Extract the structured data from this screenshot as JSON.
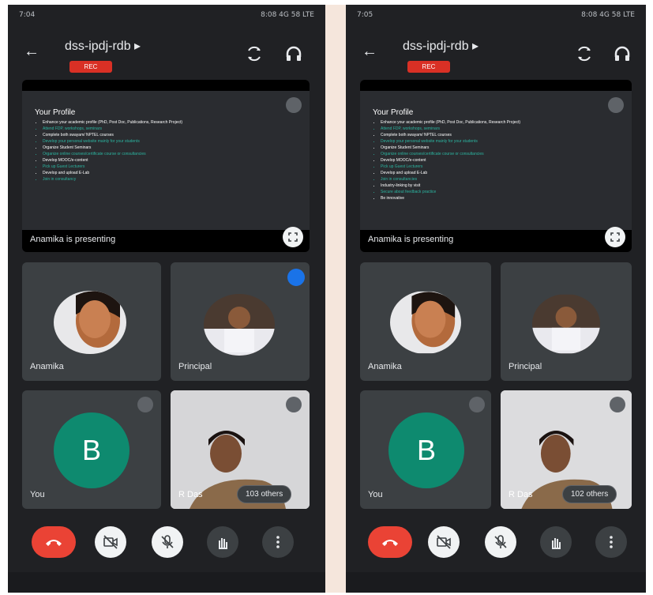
{
  "panels": [
    {
      "status": {
        "time": "7:04",
        "right": "8:08 4G 58 LTE"
      },
      "meeting_code": "dss-ipdj-rdb ▸",
      "rec_label": "REC",
      "presentation": {
        "slide_title": "Your Profile",
        "bullets": [
          "Enhance your academic profile (PhD, Post Doc, Publications, Research Project)",
          "Attend FDP, workshops, seminars",
          "Complete both swayam/ NPTEL courses",
          "Develop your personal website mainly for your students",
          "Organize Student Seminars",
          "Organize online courses/certificate course or consultancies",
          "Develop MOOC/e-content",
          "Pick up Guest Lecturers",
          "Develop and upload E-Lab",
          "Join in consultancy"
        ],
        "presenting_label": "Anamika is presenting"
      },
      "tiles": {
        "anamika": "Anamika",
        "principal": "Principal",
        "you": "You",
        "you_initial": "B",
        "fourth": "R Das",
        "others": "103 others"
      }
    },
    {
      "status": {
        "time": "7:05",
        "right": "8:08 4G 58 LTE"
      },
      "meeting_code": "dss-ipdj-rdb ▸",
      "rec_label": "REC",
      "presentation": {
        "slide_title": "Your Profile",
        "bullets": [
          "Enhance your academic profile (PhD, Post Doc, Publications, Research Project)",
          "Attend FDP, workshops, seminars",
          "Complete both swayam/ NPTEL courses",
          "Develop your personal website mainly for your students",
          "Organize Student Seminars",
          "Organize online courses/certificate course or consultancies",
          "Develop MOOC/e-content",
          "Pick up Guest Lecturers",
          "Develop and upload E-Lab",
          "Join in consultancies",
          "Industry-linking by visit",
          "Secure about feedback practice",
          "Be innovative"
        ],
        "presenting_label": "Anamika is presenting"
      },
      "tiles": {
        "anamika": "Anamika",
        "principal": "Principal",
        "you": "You",
        "you_initial": "B",
        "fourth": "R Das",
        "others": "102 others"
      }
    }
  ],
  "icons": [
    "back-arrow-icon",
    "switch-camera-icon",
    "headphones-icon",
    "mic-off-icon",
    "fullscreen-icon",
    "end-call-icon",
    "camera-off-icon",
    "raise-hand-icon",
    "more-options-icon"
  ],
  "colors": {
    "rec": "#d93025",
    "end_call": "#ea4335",
    "avatar_b": "#0e8a6f",
    "speaking": "#1a73e8",
    "bullet_green": "#2bb5a0"
  }
}
